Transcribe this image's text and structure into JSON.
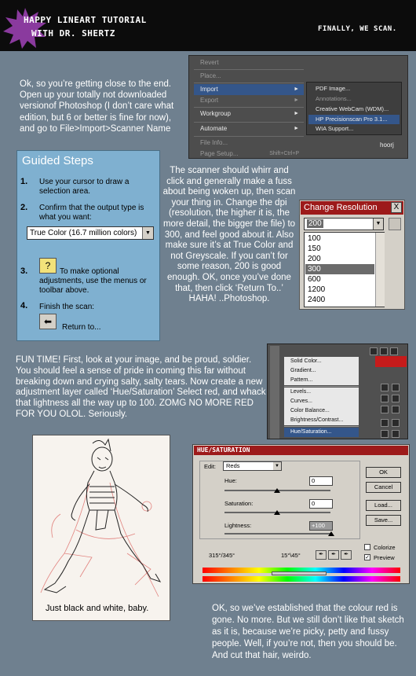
{
  "header": {
    "title_line1": "Happy lineart tutorial",
    "title_line2": "with Dr. Shertz",
    "right_text": "Finally, we scan."
  },
  "intro_text": "Ok, so you’re getting close to the end. Open up your totally not downloaded versionof Photoshop (I don’t care what edition, but 6 or better is fine for now), and go to File>Import>Scanner Name",
  "file_menu": {
    "items": [
      {
        "label": "Revert",
        "disabled": true
      },
      {
        "label": "Place...",
        "disabled": true
      },
      {
        "label": "Import",
        "highlighted": true,
        "submenu": true
      },
      {
        "label": "Export",
        "disabled": true,
        "submenu": true
      },
      {
        "label": "Workgroup",
        "submenu": true
      },
      {
        "label": "Automate",
        "submenu": true
      },
      {
        "label": "File Info...",
        "disabled": true
      },
      {
        "label": "Page Setup...",
        "shortcut": "Shift+Ctrl+P",
        "disabled": true
      }
    ],
    "submenu": [
      {
        "label": "PDF Image..."
      },
      {
        "label": "Annotations...",
        "disabled": true
      },
      {
        "label": "Creative WebCam (WDM)..."
      },
      {
        "label": "HP Precisionscan Pro 3.1...",
        "highlighted": true
      },
      {
        "label": "WIA Support..."
      }
    ],
    "user_label": "hoorj"
  },
  "guided_steps": {
    "title": "Guided Steps",
    "steps": [
      {
        "num": "1.",
        "text": "Use your cursor to draw a selection area."
      },
      {
        "num": "2.",
        "text": "Confirm that the output type is what you want:"
      },
      {
        "num": "3.",
        "text": "To make optional adjustments, use the menus or toolbar above."
      },
      {
        "num": "4.",
        "text": "Finish the scan:"
      }
    ],
    "output_type": "True Color (16.7 million colors)",
    "help_icon": "?",
    "return_label": "Return to..."
  },
  "scanner_text": "The scanner should whirr and click and generally make a fuss about being woken up, then scan your thing in. Change the dpi (resolution, the higher it is, the more detail, the bigger the file) to 300, and feel good about it. Also make sure it’s at True Color and not Greyscale. If you can’t for some reason, 200 is good enough. OK, once you’ve done that, then click ‘Return To..’ HAHA! ..Photoshop.",
  "change_resolution": {
    "title": "Change Resolution",
    "close": "X",
    "current": "200",
    "options": [
      "100",
      "150",
      "200",
      "300",
      "600",
      "1200",
      "2400"
    ],
    "selected_index": 3
  },
  "fun_text": "FUN TIME! First, look at your image, and be proud, soldier. You should feel a sense of pride in coming this far without breaking down and crying salty, salty tears. Now create a new adjustment layer called ‘Hue/Saturation’ Select red, and whack that lightness all the way up to 100. ZOMG NO MORE RED FOR YOU OLOL. Seriously.",
  "adjust_menu": {
    "items": [
      "Solid Color...",
      "Gradient...",
      "Pattern...",
      "Levels...",
      "Curves...",
      "Color Balance...",
      "Brightness/Contrast...",
      "Hue/Saturation..."
    ],
    "highlighted_index": 7
  },
  "sketch_caption": "Just black and white, baby.",
  "hue_saturation": {
    "title": "Hue/Saturation",
    "edit_label": "Edit:",
    "edit_value": "Reds",
    "hue_label": "Hue:",
    "hue_value": "0",
    "saturation_label": "Saturation:",
    "saturation_value": "0",
    "lightness_label": "Lightness:",
    "lightness_value": "+100",
    "range_left": "315°/345°",
    "range_right": "15°\\45°",
    "buttons": [
      "OK",
      "Cancel",
      "Load...",
      "Save..."
    ],
    "colorize_label": "Colorize",
    "preview_label": "Preview",
    "colorize_checked": false,
    "preview_checked": true
  },
  "closing_text": "OK, so we’ve established that the colour red is gone. No more. But we still don’t like that sketch as it is, because we’re picky, petty and fussy people. Well, if you’re not, then you should be. And cut that hair, weirdo."
}
